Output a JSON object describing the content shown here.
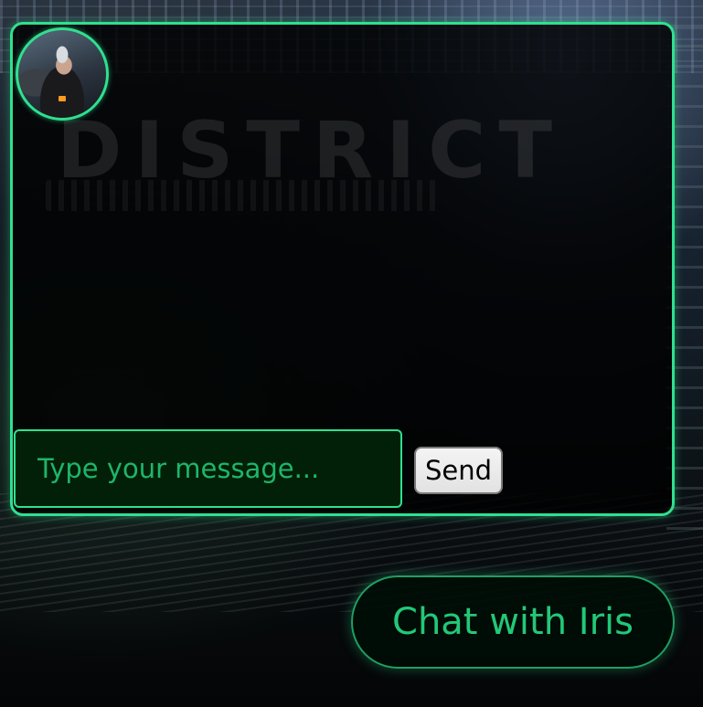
{
  "chat": {
    "assistant_name": "Iris",
    "watermark_text": "DISTRICT",
    "input": {
      "value": "",
      "placeholder": "Type your message..."
    },
    "send_label": "Send"
  },
  "launcher": {
    "label": "Chat with Iris"
  },
  "colors": {
    "accent": "#2fe08f",
    "accent_text": "#22c878",
    "input_background": "#022008"
  }
}
